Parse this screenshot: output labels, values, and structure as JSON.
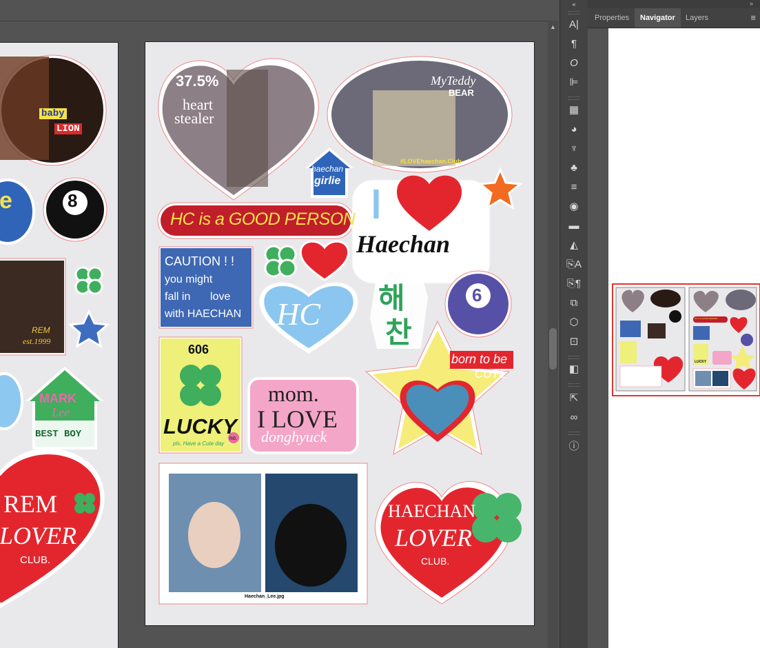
{
  "panel": {
    "tabs": [
      {
        "label": "Properties"
      },
      {
        "label": "Navigator"
      },
      {
        "label": "Layers"
      }
    ]
  },
  "stickers_main": {
    "percent": "37.5%",
    "heart1": "heart",
    "heart2": "stealer",
    "teddy1": "MyTeddy",
    "teddy2": "BEAR",
    "teddy_caption": "#LOVEhaechan.Club",
    "house1": "haechan",
    "house2": "girlie",
    "good_person": "HC is a GOOD PERSON",
    "i_letter": "I",
    "haechan_script": "Haechan",
    "caution": [
      "CAUTION ! !",
      "you might",
      "fall in",
      "love",
      "with  HAECHAN"
    ],
    "hc_mono": "HC",
    "hangul1": "해",
    "hangul2": "찬",
    "ball6": "6",
    "lucky_num": "606",
    "lucky_word": "LUCKY",
    "lucky_sub": "pls, Have a Cute day",
    "lucky_no": "no.",
    "mom1": "mom.",
    "mom2": "I LOVE",
    "mom3": "donghyuck",
    "born1": "born to be",
    "born2": "CUTE",
    "photo_caption": "Haechan_Lee.jpg",
    "lover1": "HAECHAN",
    "lover2": "LOVER",
    "lover3": "CLUB."
  },
  "stickers_left": {
    "baby": "baby",
    "lion": "LION",
    "ball8": "8",
    "rem": "REM",
    "est": "est.1999",
    "mark1": "MARK",
    "mark2": "Lee",
    "mark3": "BEST BOY",
    "rem_lover1": "REM",
    "rem_lover2": "LOVER",
    "rem_lover3": "CLUB.",
    "left_e": "e"
  },
  "nav_thumb": {
    "mini1": "HC is a GOOD PERSON",
    "mini2": "LUCKY"
  }
}
